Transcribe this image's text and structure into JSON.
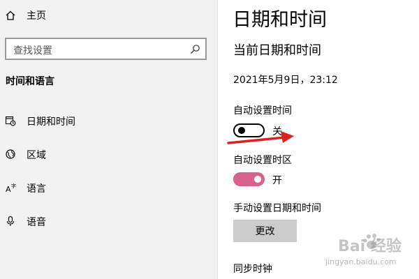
{
  "sidebar": {
    "home_label": "主页",
    "search_placeholder": "查找设置",
    "section_title": "时间和语言",
    "items": [
      {
        "label": "日期和时间",
        "icon": "calendar-clock-icon"
      },
      {
        "label": "区域",
        "icon": "globe-icon"
      },
      {
        "label": "语言",
        "icon": "language-icon"
      },
      {
        "label": "语音",
        "icon": "microphone-icon"
      }
    ]
  },
  "main": {
    "title": "日期和时间",
    "subtitle": "当前日期和时间",
    "current_datetime": "2021年5月9日，23:12",
    "auto_time": {
      "label": "自动设置时间",
      "state": "关"
    },
    "auto_timezone": {
      "label": "自动设置时区",
      "state": "开"
    },
    "manual": {
      "label": "手动设置日期和时间",
      "button": "更改"
    },
    "sync_label": "同步时钟"
  },
  "watermark": {
    "text": "Bai 经验",
    "url": "jingyan.baidu.com"
  },
  "colors": {
    "accent": "#d9628c",
    "sidebar_bg": "#f2f2f2",
    "arrow": "#e02020"
  }
}
